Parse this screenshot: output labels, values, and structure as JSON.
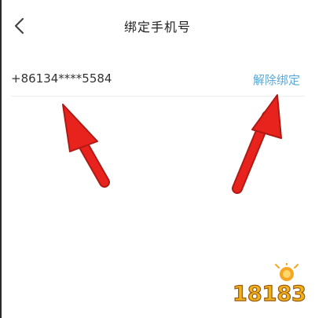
{
  "nav": {
    "title": "绑定手机号",
    "back_icon": "chevron-left-icon"
  },
  "phone_row": {
    "number": "+86134****5584",
    "action_label": "解除绑定"
  },
  "colors": {
    "action": "#5aa9d6",
    "arrow": "#e8231d",
    "text": "#333333"
  },
  "watermark": {
    "text": "18183"
  }
}
